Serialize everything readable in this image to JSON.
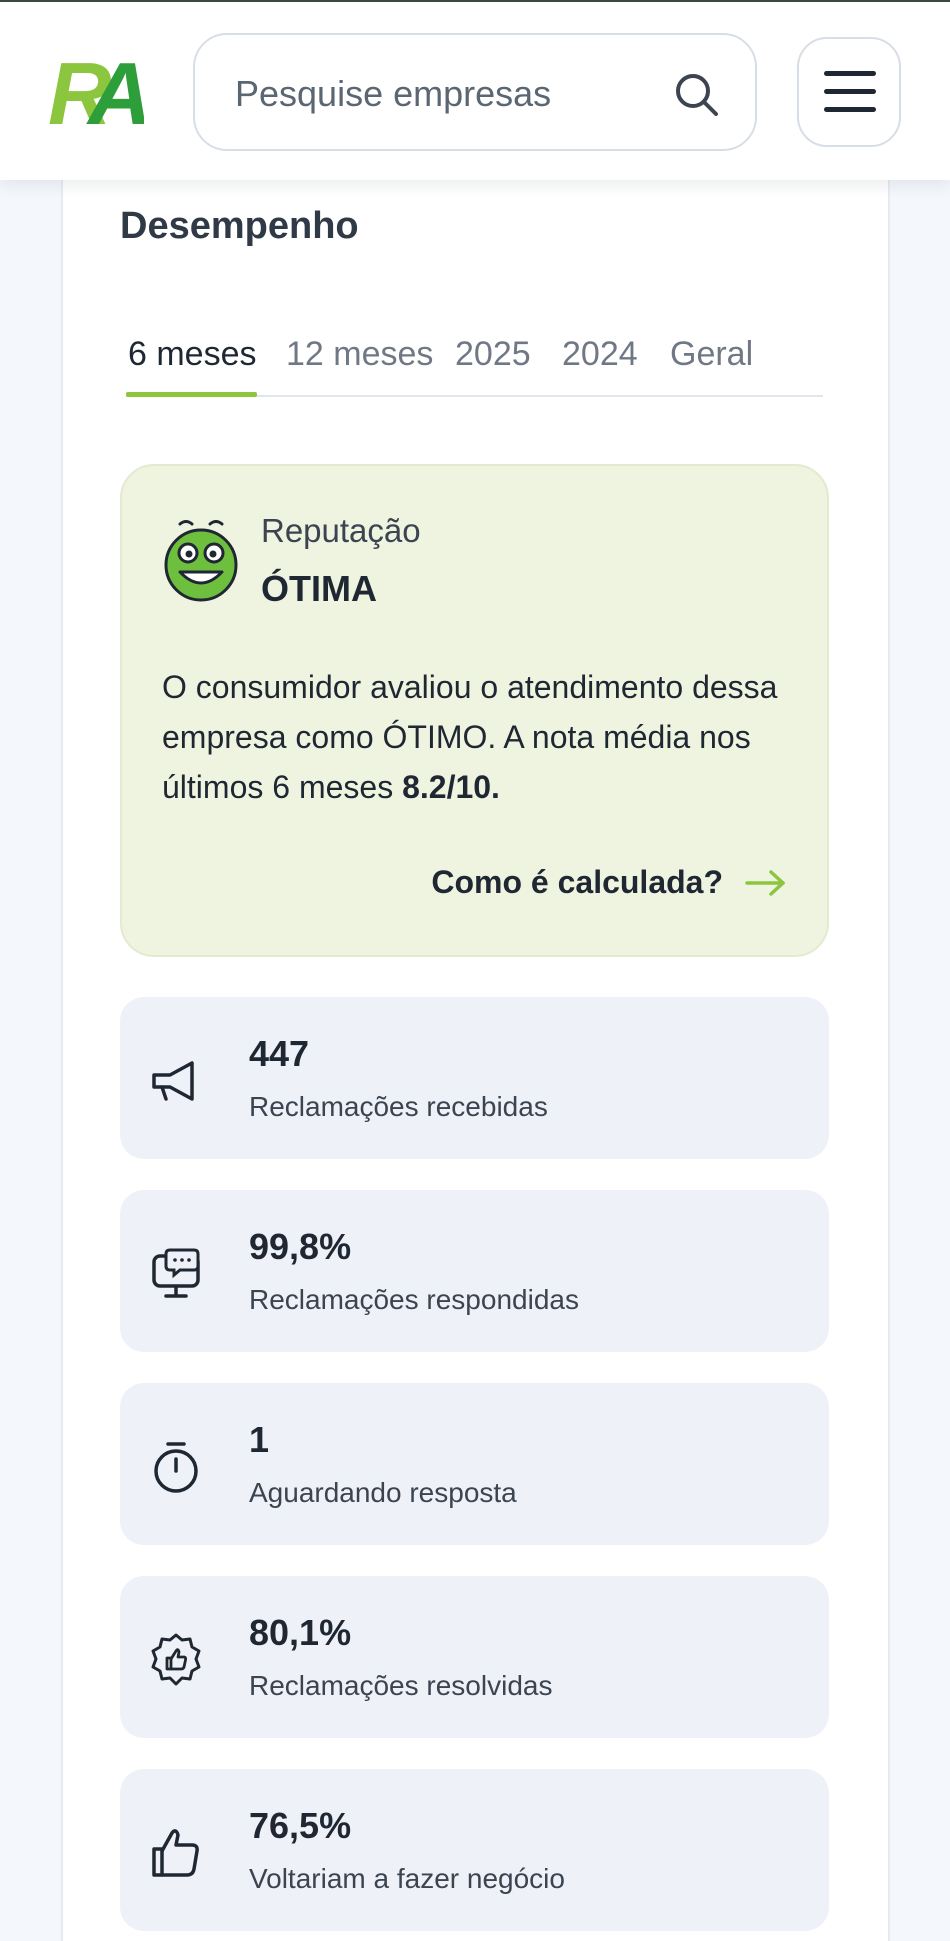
{
  "header": {
    "logo_text": "RA",
    "search_placeholder": "Pesquise empresas"
  },
  "performance": {
    "title": "Desempenho",
    "tabs": [
      {
        "label": "6 meses",
        "active": true
      },
      {
        "label": "12 meses",
        "active": false
      },
      {
        "label": "2025",
        "active": false
      },
      {
        "label": "2024",
        "active": false
      },
      {
        "label": "Geral",
        "active": false
      }
    ]
  },
  "reputation": {
    "label": "Reputação",
    "value": "ÓTIMA",
    "description_prefix": "O consumidor avaliou o atendimento dessa empresa como ÓTIMO. A nota média nos últimos 6 meses ",
    "score": "8.2/10.",
    "link_label": "Como é calculada?"
  },
  "stats": [
    {
      "icon": "megaphone-icon",
      "value": "447",
      "label": "Reclamações recebidas"
    },
    {
      "icon": "chat-monitor-icon",
      "value": "99,8%",
      "label": "Reclamações respondidas"
    },
    {
      "icon": "stopwatch-icon",
      "value": "1",
      "label": "Aguardando resposta"
    },
    {
      "icon": "thumbs-up-badge-icon",
      "value": "80,1%",
      "label": "Reclamações resolvidas"
    },
    {
      "icon": "thumbs-up-icon",
      "value": "76,5%",
      "label": "Voltariam a fazer negócio"
    }
  ],
  "colors": {
    "brand_green": "#8cc63f",
    "brand_dark_green": "#2e8b2e",
    "reputation_bg": "#eff4e1",
    "stat_bg": "#eef2f8"
  }
}
